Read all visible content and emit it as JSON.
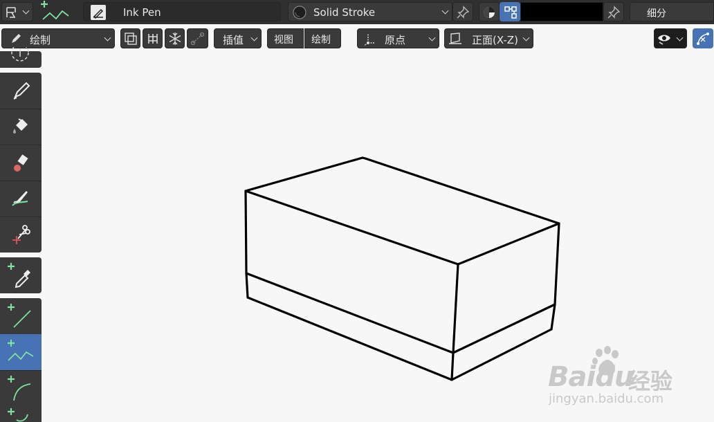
{
  "header": {
    "brush_name": "Ink Pen",
    "material_name": "Solid Stroke",
    "subdivide_label": "细分"
  },
  "toolbar": {
    "mode_label": "绘制",
    "interpolate_label": "插值",
    "view_label": "视图",
    "draw_label": "绘制",
    "origin_label": "原点",
    "plane_label": "正面(X-Z)"
  },
  "tools": [
    {
      "name": "draw-tool"
    },
    {
      "name": "fill-tool"
    },
    {
      "name": "erase-tool"
    },
    {
      "name": "tint-tool"
    },
    {
      "name": "cutter-tool"
    },
    {
      "name": "eyedropper-tool"
    },
    {
      "name": "line-tool"
    },
    {
      "name": "polyline-tool",
      "active": true
    },
    {
      "name": "arc-tool"
    },
    {
      "name": "curve-tool"
    }
  ],
  "watermark": {
    "brand": "Baidu",
    "cn": "经验",
    "url": "jingyan.baidu.com"
  },
  "colors": {
    "accent": "#4772b3",
    "header_bg": "#303030",
    "viewport_bg": "#f7f7f7",
    "stroke": "#000000",
    "add_plus": "#7ee3a0"
  }
}
